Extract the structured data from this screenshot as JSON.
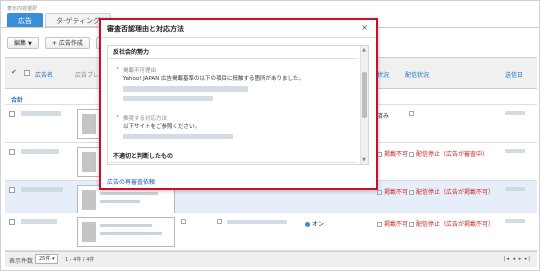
{
  "header": {
    "hint": "表示内容選択",
    "tabs": [
      {
        "label": "広告",
        "active": true
      },
      {
        "label": "タ-ゲティング",
        "active": false
      }
    ]
  },
  "toolbar": {
    "edit_label": "編集",
    "create_label": "広告作成"
  },
  "table": {
    "columns": {
      "ad_name": "広告名",
      "ad_preview": "広告プレ",
      "review_status": "状況",
      "delivery_status": "配信状況",
      "sent_date": "送信日"
    },
    "total_label": "合計",
    "rows": [
      {
        "review": "済み",
        "delivery": ""
      },
      {
        "review": "掲載不可",
        "delivery": "配信停止（広告が審査中）"
      },
      {
        "review": "掲載不可",
        "delivery": "配信停止（広告が掲載不可）"
      },
      {
        "review": "掲載不可",
        "delivery": "配信停止（広告が掲載不可）",
        "toggle": "オン"
      }
    ]
  },
  "footer": {
    "display_label": "表示件数",
    "per_page": "25件",
    "count": "1 - 4件 / 4件",
    "pager": "|◂ ◂ ▸ ▸|"
  },
  "modal": {
    "title": "審査否認理由と対応方法",
    "close": "×",
    "section1": {
      "title": "反社会的勢力",
      "reason_heading": "掲載不可理由",
      "reason_text": "Yahoo! JAPAN 広告掲載基準の以下の項目に抵触する箇所がありました。",
      "action_heading": "推奨する対応方法",
      "action_text": "以下サイトをご参照ください。"
    },
    "section2": {
      "title": "不適切と判断したもの"
    },
    "link": "広告の再審査依頼"
  },
  "colors": {
    "accent": "#3a8dd8",
    "modal_border": "#c8102e",
    "error": "#d02020",
    "link": "#1a5fb4"
  }
}
